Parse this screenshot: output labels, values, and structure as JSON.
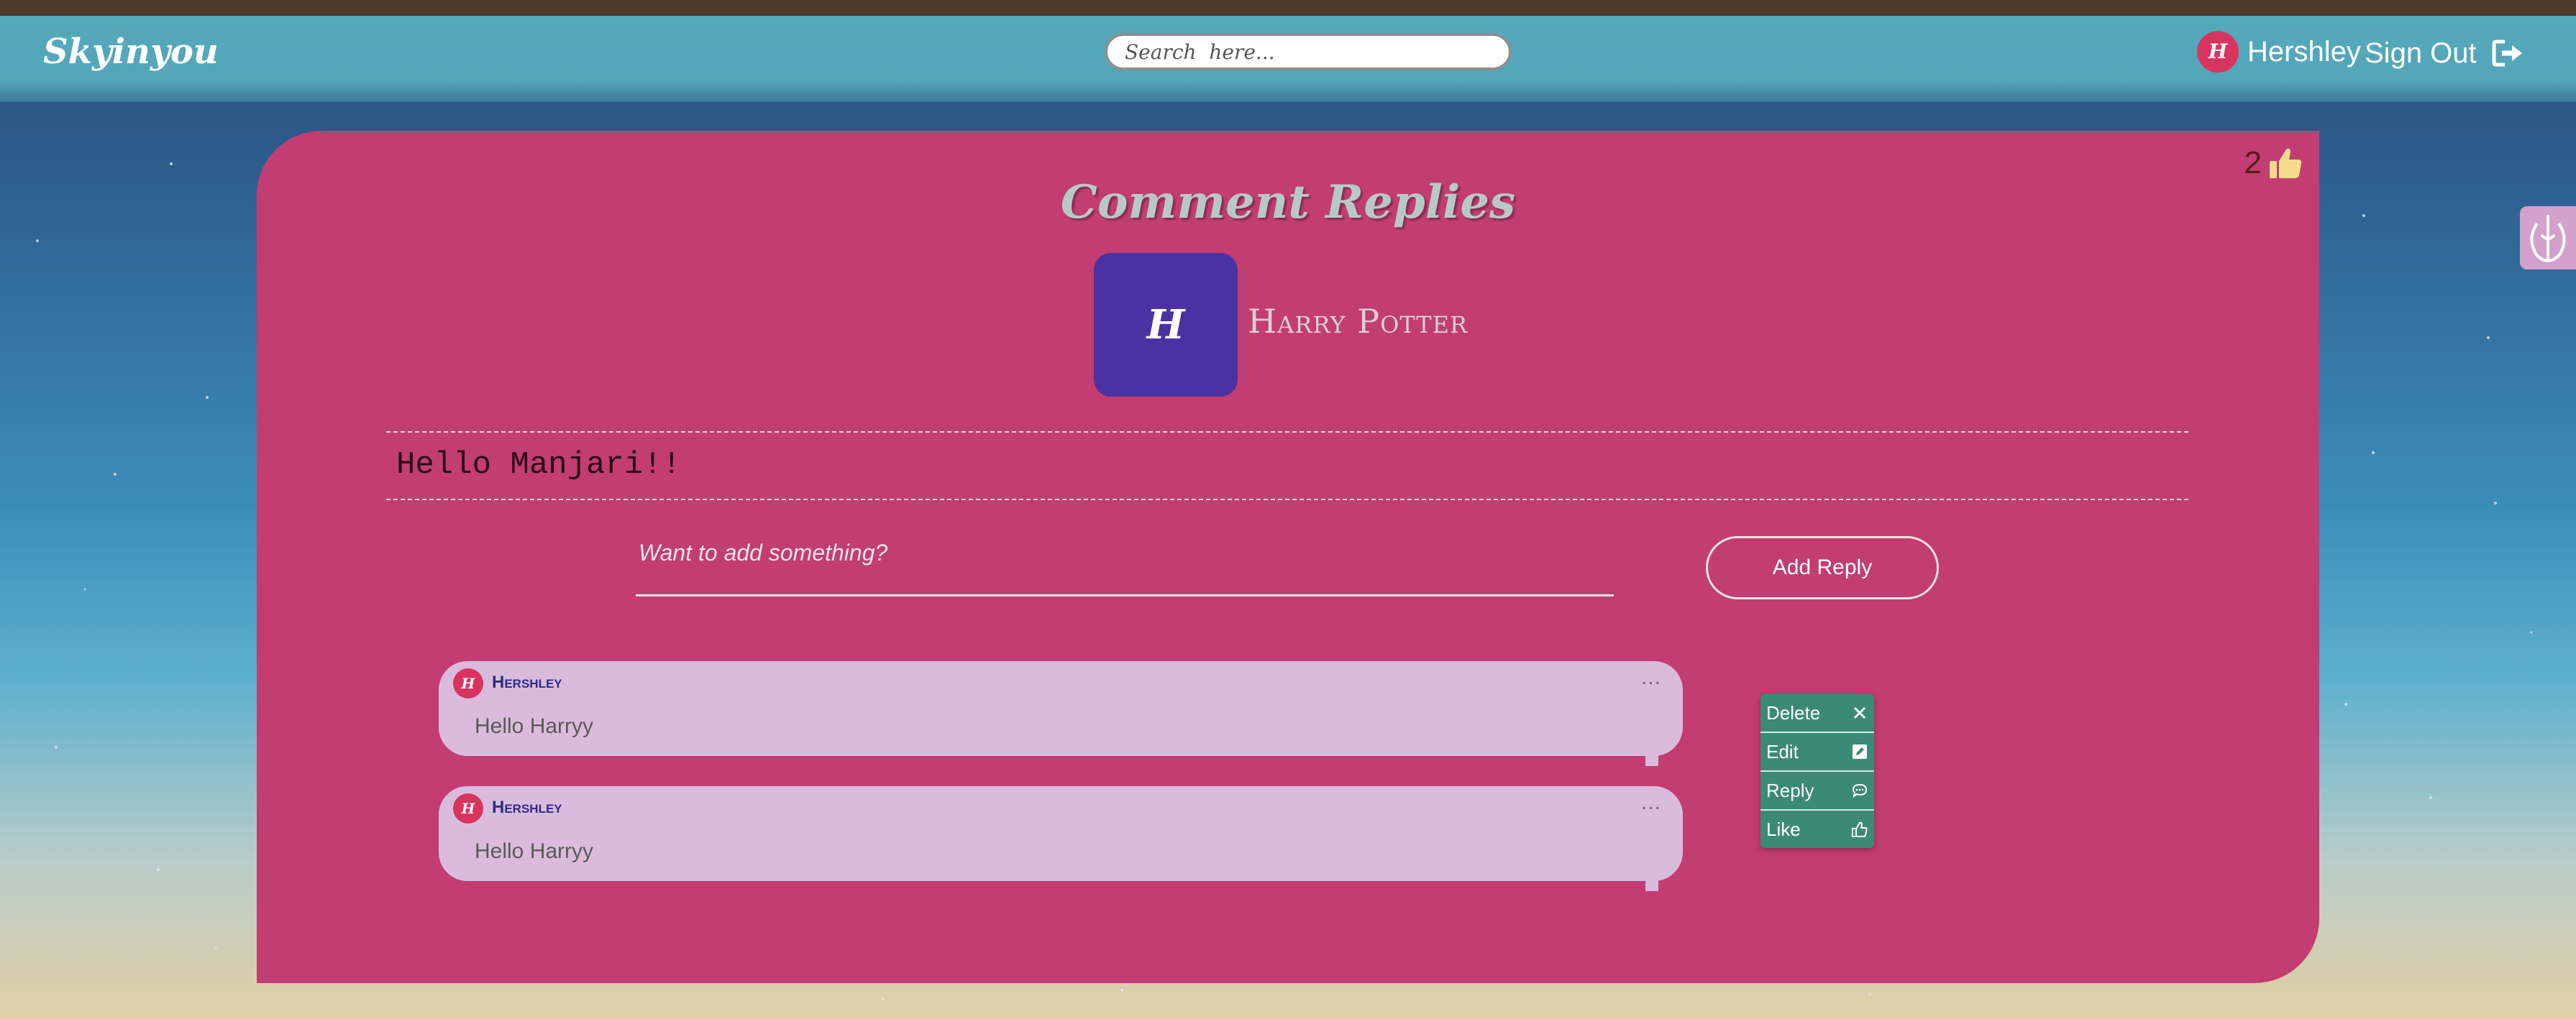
{
  "app": {
    "brand": "Skyinyou"
  },
  "search": {
    "placeholder": "Search  here..."
  },
  "user": {
    "initial": "H",
    "name": "Hershley",
    "signout_label": "Sign Out"
  },
  "page": {
    "title": "Comment Replies",
    "like_count": "2",
    "author": {
      "initial": "H",
      "name": "Harry Potter"
    },
    "comment_text": "Hello Manjari!!"
  },
  "reply_form": {
    "placeholder": "Want to add something?",
    "button_label": "Add Reply"
  },
  "replies": [
    {
      "initial": "H",
      "author": "Hershley",
      "text": "Hello Harryy",
      "more": "..."
    },
    {
      "initial": "H",
      "author": "Hershley",
      "text": "Hello Harryy",
      "more": "..."
    }
  ],
  "context_menu": {
    "items": [
      {
        "label": "Delete",
        "icon": "close-icon"
      },
      {
        "label": "Edit",
        "icon": "edit-icon"
      },
      {
        "label": "Reply",
        "icon": "comment-icon"
      },
      {
        "label": "Like",
        "icon": "thumbs-up-icon"
      }
    ]
  },
  "colors": {
    "navbar": "#55a9bb",
    "card": "#c23d72",
    "bubble": "#dbbbdc",
    "menu": "#3b8a78",
    "avatar": "#d8345f",
    "author_avatar": "#4a32a2"
  }
}
